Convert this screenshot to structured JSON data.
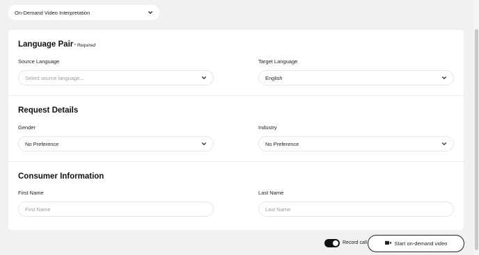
{
  "service_select": {
    "value": "On-Demand Video Interpretation"
  },
  "language_pair": {
    "title": "Language Pair",
    "required_note": "* Required",
    "source": {
      "label": "Source Language",
      "placeholder": "Select source language..."
    },
    "target": {
      "label": "Target Language",
      "value": "English"
    }
  },
  "request_details": {
    "title": "Request Details",
    "gender": {
      "label": "Gender",
      "value": "No Preference"
    },
    "industry": {
      "label": "Industry",
      "value": "No Preference"
    }
  },
  "consumer_information": {
    "title": "Consumer Information",
    "first_name": {
      "label": "First Name",
      "placeholder": "First Name"
    },
    "last_name": {
      "label": "Last Name",
      "placeholder": "Last Name"
    }
  },
  "footer": {
    "record_call_label": "Record call",
    "record_call_on": true,
    "start_button_label": "Start on-demand video"
  },
  "icons": {
    "dropdown": "chevron-down-icon",
    "video": "video-camera-icon"
  }
}
